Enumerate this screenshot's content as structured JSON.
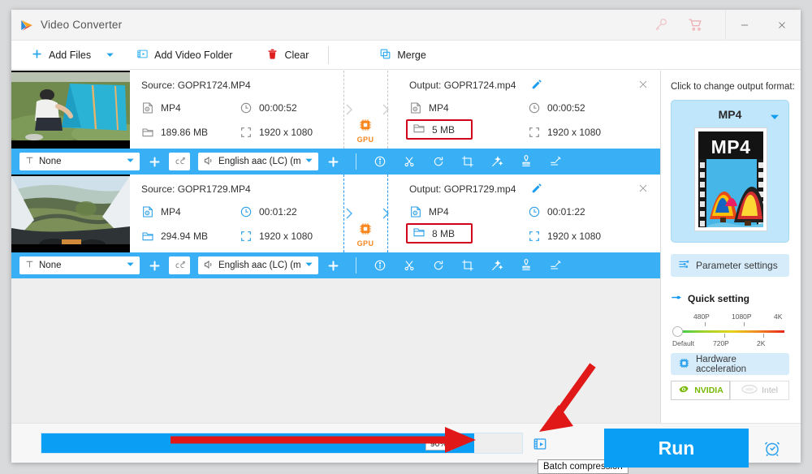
{
  "window": {
    "app_title": "Video Converter",
    "logo_icon": "play-triangle-logo",
    "key_icon": "key-icon",
    "cart_icon": "shopping-cart-icon",
    "minimize_label": "–",
    "close_label": "✕"
  },
  "toolbar": {
    "add_files": "Add Files",
    "add_files_icon": "plus-icon",
    "add_files_caret_icon": "chevron-down-icon",
    "add_video_folder": "Add Video Folder",
    "add_video_folder_icon": "folder-video-icon",
    "clear": "Clear",
    "clear_icon": "trash-icon",
    "merge": "Merge",
    "merge_icon": "merge-squares-icon"
  },
  "files": [
    {
      "source_label": "Source: GOPR1724.MP4",
      "source": {
        "format": "MP4",
        "duration": "00:00:52",
        "size": "189.86 MB",
        "resolution": "1920 x 1080"
      },
      "output_label": "Output: GOPR1724.mp4",
      "output": {
        "format": "MP4",
        "duration": "00:00:52",
        "size": "5 MB",
        "resolution": "1920 x 1080"
      },
      "gpu_badge": "GPU",
      "highlighted_size": true,
      "icon_state": "gray",
      "thumbnail": "camping-tent-scene",
      "actions": {
        "subtitle_value": "None",
        "subtitle_icon": "subtitle-T-icon",
        "add_subtitle_icon": "plus-icon",
        "cc_icon": "cc-icon",
        "audio_value": "English aac (LC) (mp",
        "audio_icon": "speaker-icon",
        "add_audio_icon": "plus-icon",
        "tools": [
          {
            "name": "info-icon",
            "title": "Info"
          },
          {
            "name": "scissors-icon",
            "title": "Cut"
          },
          {
            "name": "rotate-icon",
            "title": "Rotate"
          },
          {
            "name": "crop-icon",
            "title": "Crop"
          },
          {
            "name": "magic-wand-icon",
            "title": "Effect"
          },
          {
            "name": "watermark-stamp-icon",
            "title": "Watermark"
          },
          {
            "name": "subtitle-edit-icon",
            "title": "Subtitle"
          }
        ]
      }
    },
    {
      "source_label": "Source: GOPR1729.MP4",
      "source": {
        "format": "MP4",
        "duration": "00:01:22",
        "size": "294.94 MB",
        "resolution": "1920 x 1080"
      },
      "output_label": "Output: GOPR1729.mp4",
      "output": {
        "format": "MP4",
        "duration": "00:01:22",
        "size": "8 MB",
        "resolution": "1920 x 1080"
      },
      "gpu_badge": "GPU",
      "highlighted_size": true,
      "icon_state": "blue",
      "thumbnail": "pov-road-scene",
      "actions": {
        "subtitle_value": "None",
        "subtitle_icon": "subtitle-T-icon",
        "add_subtitle_icon": "plus-icon",
        "cc_icon": "cc-icon",
        "audio_value": "English aac (LC) (mp",
        "audio_icon": "speaker-icon",
        "add_audio_icon": "plus-icon",
        "tools": [
          {
            "name": "info-icon",
            "title": "Info"
          },
          {
            "name": "scissors-icon",
            "title": "Cut"
          },
          {
            "name": "rotate-icon",
            "title": "Rotate"
          },
          {
            "name": "crop-icon",
            "title": "Crop"
          },
          {
            "name": "magic-wand-icon",
            "title": "Effect"
          },
          {
            "name": "watermark-stamp-icon",
            "title": "Watermark"
          },
          {
            "name": "subtitle-edit-icon",
            "title": "Subtitle"
          }
        ]
      }
    }
  ],
  "sidebar": {
    "output_format_title": "Click to change output format:",
    "format_name": "MP4",
    "format_caret_icon": "chevron-down-icon",
    "format_thumb_label": "MP4",
    "parameter_settings": "Parameter settings",
    "parameter_settings_icon": "sliders-icon",
    "quick_setting": "Quick setting",
    "quick_setting_icon": "slider-handle-icon",
    "quality_ticks_top": [
      "480P",
      "1080P",
      "4K"
    ],
    "quality_ticks_bottom": [
      "Default",
      "720P",
      "2K"
    ],
    "quality_value": "Default",
    "hardware_acceleration": "Hardware acceleration",
    "hardware_acceleration_icon": "chip-icon",
    "gpu_options": [
      {
        "label": "NVIDIA",
        "icon": "nvidia-eye-icon",
        "enabled": true
      },
      {
        "label": "Intel",
        "icon": "intel-icon",
        "enabled": false
      }
    ]
  },
  "bottom": {
    "progress_percent": "90%",
    "progress_value": 90,
    "batch_icon": "batch-compression-icon",
    "tooltip": "Batch compression",
    "run_label": "Run",
    "alarm_icon": "alarm-clock-icon"
  },
  "colors": {
    "accent": "#0b9ef5",
    "action_bar": "#39b0f5",
    "highlight_red": "#d0021b",
    "gpu_orange": "#f6871f",
    "nvidia_green": "#76b900"
  }
}
